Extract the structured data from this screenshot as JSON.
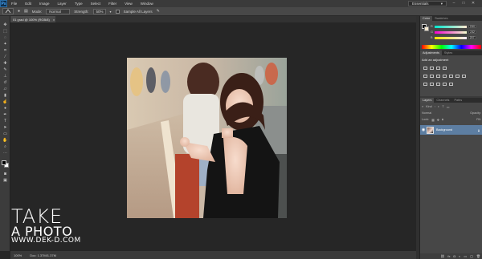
{
  "app": {
    "logo": "Ps",
    "menu": [
      "File",
      "Edit",
      "Image",
      "Layer",
      "Type",
      "Select",
      "Filter",
      "View",
      "Window"
    ],
    "workspace": "Essentials",
    "window_controls": [
      "–",
      "□",
      "✕"
    ]
  },
  "options_bar": {
    "mode_label": "Mode:",
    "mode_value": "Normal",
    "strength_label": "Strength:",
    "strength_value": "50%",
    "sample_all_layers": "Sample All Layers"
  },
  "document": {
    "tab_title": "01 grad @ 100% (RGB/8)",
    "tab_close": "×"
  },
  "status": {
    "zoom": "100%",
    "doc_size": "Doc: 1.37M/1.37M"
  },
  "panels": {
    "color_tabs": [
      "Color",
      "Swatches"
    ],
    "color_channels": [
      {
        "label": "R",
        "value": "244"
      },
      {
        "label": "G",
        "value": "232"
      },
      {
        "label": "B",
        "value": "207"
      }
    ],
    "adjust_tabs": [
      "Adjustments",
      "Styles"
    ],
    "adjust_title": "Add an adjustment",
    "layers_tabs": [
      "Layers",
      "Channels",
      "Paths"
    ],
    "layers_kind": "Kind",
    "layers_blend": "Normal",
    "layers_opacity": "Opacity:",
    "layers_lock": "Lock:",
    "layers_fill": "Fill:",
    "layer_name": "Background"
  },
  "watermark": {
    "line1": "TAKE",
    "line2": "A PHOTO",
    "line3": "WWW.DEK-D.COM"
  },
  "colors": {
    "accent_selection": "#5d7ea2",
    "panel_bg": "#474747",
    "canvas_bg": "#262626"
  }
}
